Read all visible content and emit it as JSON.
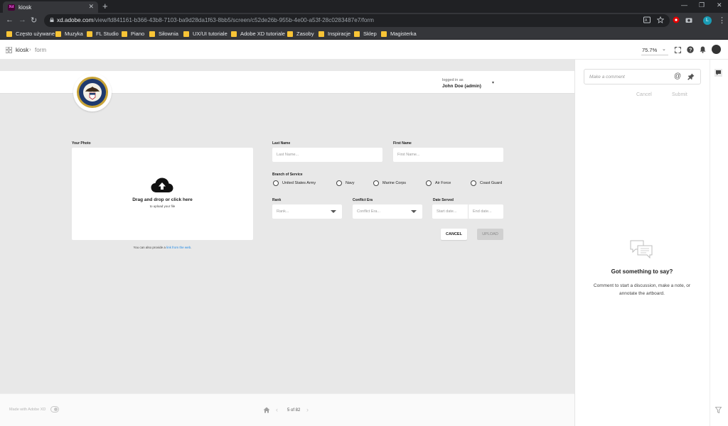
{
  "browser": {
    "tab_title": "kiosk",
    "tab_favicon": "Xd",
    "url_host": "xd.adobe.com",
    "url_path": "/view/fd841161-b366-43b8-7103-ba9d28da1f63-8bb5/screen/c52de26b-955b-4e00-a53f-28c0283487e7/form",
    "profile_initial": "L",
    "bookmarks": [
      "Często używane",
      "Muzyka",
      "FL Studio",
      "Piano",
      "Siłownia",
      "UX/UI tutoriale",
      "Adobe XD tutoriale",
      "Zasoby",
      "Inspiracje",
      "Sklep",
      "Magisterka"
    ]
  },
  "xd_header": {
    "breadcrumb_root": "kiosk",
    "breadcrumb_current": "form",
    "zoom": "75.7%"
  },
  "form": {
    "logged_in_label": "logged in as",
    "logged_in_user": "John Doe (admin)",
    "photo_label": "Your Photo",
    "upload_title": "Drag and drop or click here",
    "upload_subtitle": "to upload your file",
    "link_note_prefix": "You can also provide a ",
    "link_note_link": "link from the web",
    "link_note_suffix": ".",
    "last_name_label": "Last Name",
    "last_name_placeholder": "Last Name...",
    "first_name_label": "First Name",
    "first_name_placeholder": "First Name...",
    "branch_label": "Branch of Service",
    "branches": [
      "United States Army",
      "Navy",
      "Marine Corps",
      "Air Force",
      "Coast Guard"
    ],
    "rank_label": "Rank",
    "rank_placeholder": "Rank...",
    "era_label": "Conflict Era",
    "era_placeholder": "Conflict Era...",
    "date_label": "Date Served",
    "start_placeholder": "Start date...",
    "end_placeholder": "End date...",
    "cancel_label": "CANCEL",
    "upload_label": "UPLOAD"
  },
  "footer": {
    "made_with": "Made with Adobe XD",
    "page_count": "5 of 82"
  },
  "comments": {
    "placeholder": "Make a comment",
    "cancel_label": "Cancel",
    "submit_label": "Submit",
    "empty_title": "Got something to say?",
    "empty_desc": "Comment to start a discussion, make a note, or annotate the artboard."
  },
  "colors": {
    "browser_dark": "#202124",
    "browser_toolbar": "#35363a",
    "canvas": "#e8e8e8",
    "link": "#1e88e5",
    "upload_disabled": "#d0d0d0"
  }
}
